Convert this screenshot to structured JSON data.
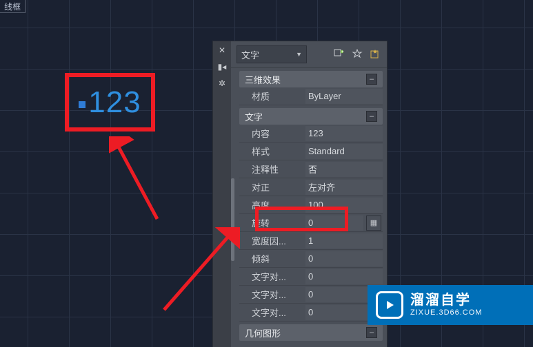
{
  "viewport": {
    "top_tab_label": "线框",
    "model_text": "123"
  },
  "palette": {
    "object_type": "文字",
    "sections": {
      "effects": {
        "title": "三维效果"
      },
      "text": {
        "title": "文字"
      },
      "geom": {
        "title": "几何图形"
      }
    },
    "props": {
      "material": {
        "label": "材质",
        "value": "ByLayer"
      },
      "content": {
        "label": "内容",
        "value": "123"
      },
      "style": {
        "label": "样式",
        "value": "Standard"
      },
      "annotative": {
        "label": "注释性",
        "value": "否"
      },
      "justify": {
        "label": "对正",
        "value": "左对齐"
      },
      "height": {
        "label": "高度",
        "value": "100"
      },
      "rotation": {
        "label": "旋转",
        "value": "0"
      },
      "width_factor": {
        "label": "宽度因...",
        "value": "1"
      },
      "oblique": {
        "label": "倾斜",
        "value": "0"
      },
      "align1": {
        "label": "文字对...",
        "value": "0"
      },
      "align2": {
        "label": "文字对...",
        "value": "0"
      },
      "align3": {
        "label": "文字对...",
        "value": "0"
      }
    }
  },
  "watermark": {
    "title": "溜溜自学",
    "sub": "ZIXUE.3D66.COM"
  }
}
